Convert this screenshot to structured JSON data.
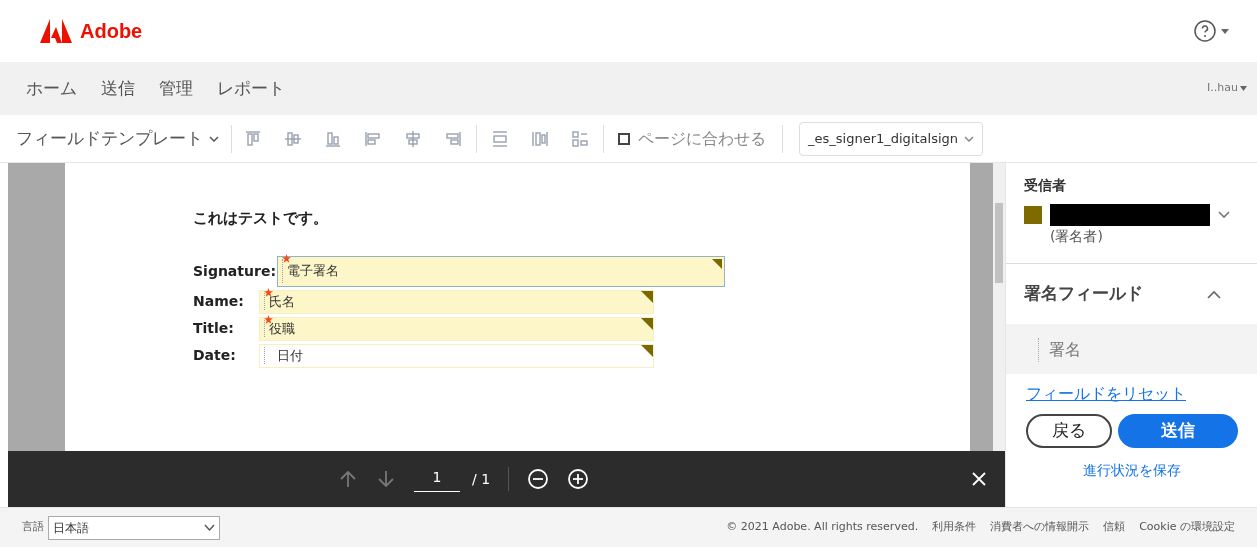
{
  "header": {
    "brand": "Adobe"
  },
  "nav": {
    "items": [
      {
        "label": "ホーム"
      },
      {
        "label": "送信"
      },
      {
        "label": "管理"
      },
      {
        "label": "レポート"
      }
    ],
    "user": "I..hau"
  },
  "toolbar": {
    "template": "フィールドテンプレート",
    "fit_page": {
      "label": "ページに合わせる",
      "checked": false
    },
    "field_select": "_es_signer1_digitalsign"
  },
  "document": {
    "heading": "これはテストです。",
    "fields": [
      {
        "label": "Signature:",
        "placeholder": "電子署名",
        "required": true,
        "selected": true
      },
      {
        "label": "Name:",
        "placeholder": "氏名",
        "required": true,
        "selected": false
      },
      {
        "label": "Title:",
        "placeholder": "役職",
        "required": true,
        "selected": false
      },
      {
        "label": "Date:",
        "placeholder": "日付",
        "required": false,
        "selected": false
      }
    ]
  },
  "pager": {
    "page": "1",
    "total": "/ 1"
  },
  "panel": {
    "recipients_title": "受信者",
    "recipient": {
      "color": "#7f6a00",
      "role": "(署名者)"
    },
    "section_title": "署名フィールド",
    "section_expanded": true,
    "section_items": [
      "署名"
    ],
    "reset": "フィールドをリセット",
    "back": "戻る",
    "send": "送信",
    "save": "進行状況を保存"
  },
  "footer": {
    "language_label": "言語",
    "language": "日本語",
    "copyright": "© 2021 Adobe. All rights reserved.",
    "links": [
      "利用条件",
      "消費者への情報開示",
      "信頼",
      "Cookie の環境設定"
    ]
  }
}
